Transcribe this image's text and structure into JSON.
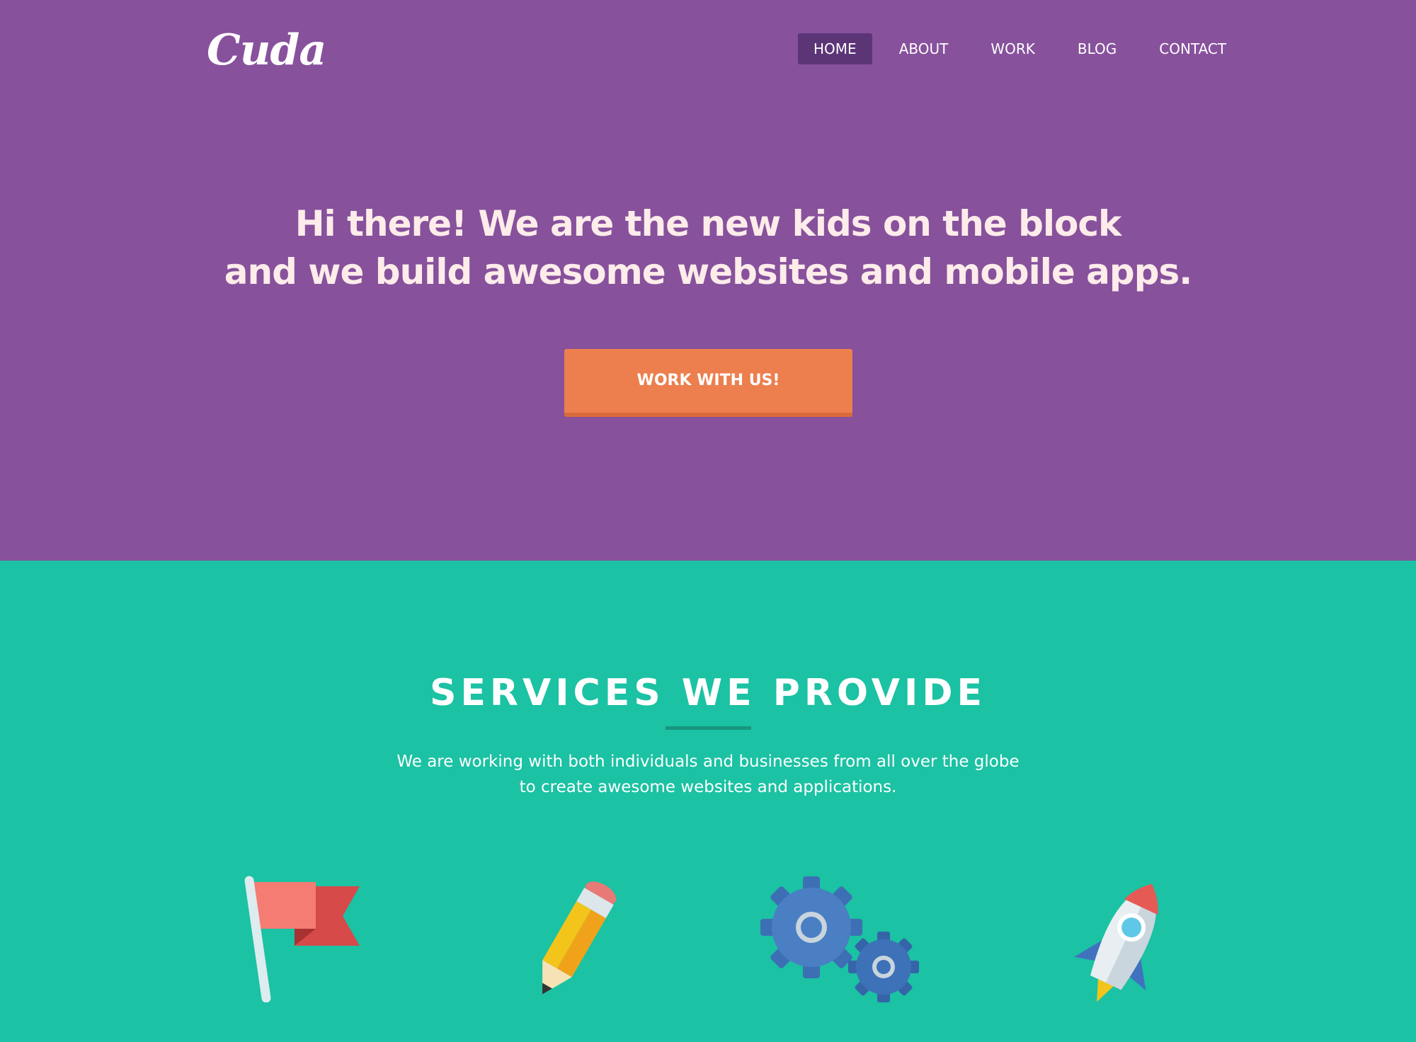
{
  "header": {
    "logo_text": "Cuda",
    "nav": [
      {
        "label": "HOME",
        "active": true
      },
      {
        "label": "ABOUT",
        "active": false
      },
      {
        "label": "WORK",
        "active": false
      },
      {
        "label": "BLOG",
        "active": false
      },
      {
        "label": "CONTACT",
        "active": false
      }
    ]
  },
  "hero": {
    "title_line1": "Hi there! We are the new kids on the block",
    "title_line2": "and we build awesome websites and mobile apps.",
    "cta_label": "WORK WITH US!"
  },
  "services": {
    "title": "SERVICES WE PROVIDE",
    "desc_line1": "We are working with both individuals and businesses from all over the globe",
    "desc_line2": "to create awesome websites and applications.",
    "icons": [
      "flag-icon",
      "pencil-icon",
      "gears-icon",
      "rocket-icon"
    ]
  },
  "colors": {
    "hero_bg": "#87519c",
    "nav_active_bg": "#5c3577",
    "cta_bg": "#ec7f4d",
    "services_bg": "#1bc2a3",
    "divider": "#17967e"
  }
}
